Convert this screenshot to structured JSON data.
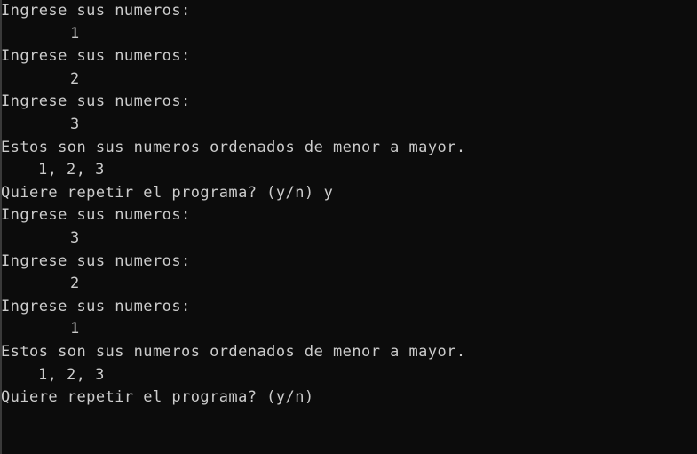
{
  "terminal": {
    "background": "#0c0c0c",
    "foreground": "#cccccc"
  },
  "session": {
    "run1": {
      "prompt1": "Ingrese sus numeros:",
      "value1": "1",
      "prompt2": "Ingrese sus numeros:",
      "value2": "2",
      "prompt3": "Ingrese sus numeros:",
      "value3": "3",
      "sorted_message": "Estos son sus numeros ordenados de menor a mayor.",
      "sorted_result": "1, 2, 3",
      "repeat_prompt": "Quiere repetir el programa? (y/n)",
      "repeat_answer": "y"
    },
    "run2": {
      "prompt1": "Ingrese sus numeros:",
      "value1": "3",
      "prompt2": "Ingrese sus numeros:",
      "value2": "2",
      "prompt3": "Ingrese sus numeros:",
      "value3": "1",
      "sorted_message": "Estos son sus numeros ordenados de menor a mayor.",
      "sorted_result": "1, 2, 3",
      "repeat_prompt": "Quiere repetir el programa? (y/n)"
    }
  }
}
